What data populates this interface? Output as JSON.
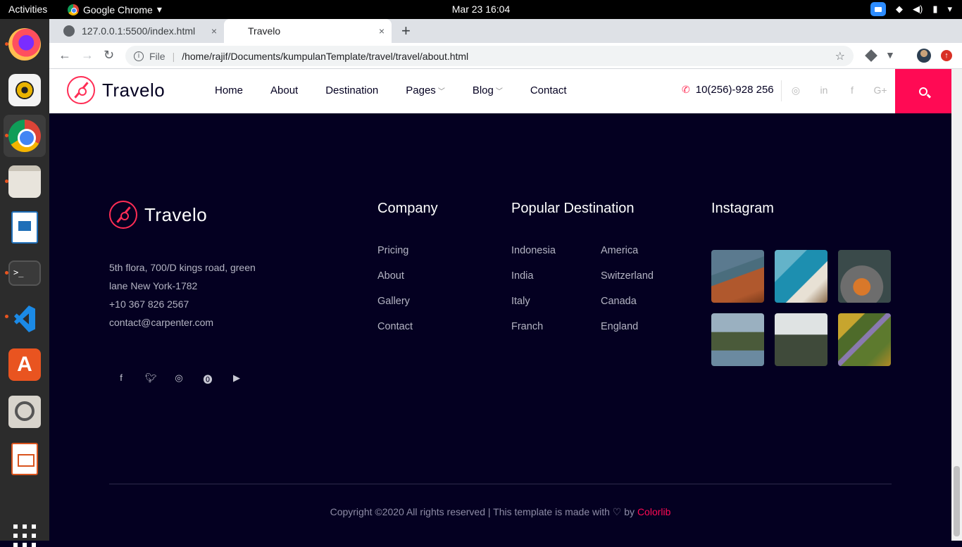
{
  "topbar": {
    "activities": "Activities",
    "app_name": "Google Chrome",
    "app_caret": "▾",
    "datetime": "Mar 23  16:04"
  },
  "browser": {
    "tabs": [
      {
        "title": "127.0.0.1:5500/index.html"
      },
      {
        "title": "Travelo"
      }
    ],
    "address_scheme_label": "File",
    "address": "/home/rajif/Documents/kumpulanTemplate/travel/travel/about.html",
    "new_tab": "+",
    "close": "×"
  },
  "site": {
    "brand": "Travelo",
    "nav": [
      {
        "label": "Home"
      },
      {
        "label": "About"
      },
      {
        "label": "Destination"
      },
      {
        "label": "Pages",
        "has_dropdown": true
      },
      {
        "label": "Blog",
        "has_dropdown": true
      },
      {
        "label": "Contact"
      }
    ],
    "phone": "10(256)-928 256",
    "header_socials": [
      "instagram-icon",
      "linkedin-icon",
      "facebook-icon",
      "google-plus-icon"
    ],
    "accent_color": "#ff0a54"
  },
  "footer": {
    "brand": "Travelo",
    "address_lines": [
      "5th flora, 700/D kings road, green",
      "lane New York-1782",
      "+10 367 826 2567",
      "contact@carpenter.com"
    ],
    "socials": [
      "facebook-icon",
      "twitter-icon",
      "instagram-icon",
      "pinterest-icon",
      "youtube-icon"
    ],
    "company": {
      "title": "Company",
      "links": [
        "Pricing",
        "About",
        "Gallery",
        "Contact"
      ]
    },
    "popular": {
      "title": "Popular Destination",
      "col1": [
        "Indonesia",
        "India",
        "Italy",
        "Franch"
      ],
      "col2": [
        "America",
        "Switzerland",
        "Canada",
        "England"
      ]
    },
    "instagram": {
      "title": "Instagram",
      "photos": 6
    },
    "copyright_prefix": "Copyright ©2020 All rights reserved | This template is made with ",
    "heart": "♡",
    "by": " by ",
    "brand_credit": "Colorlib",
    "background_color": "#040021"
  }
}
